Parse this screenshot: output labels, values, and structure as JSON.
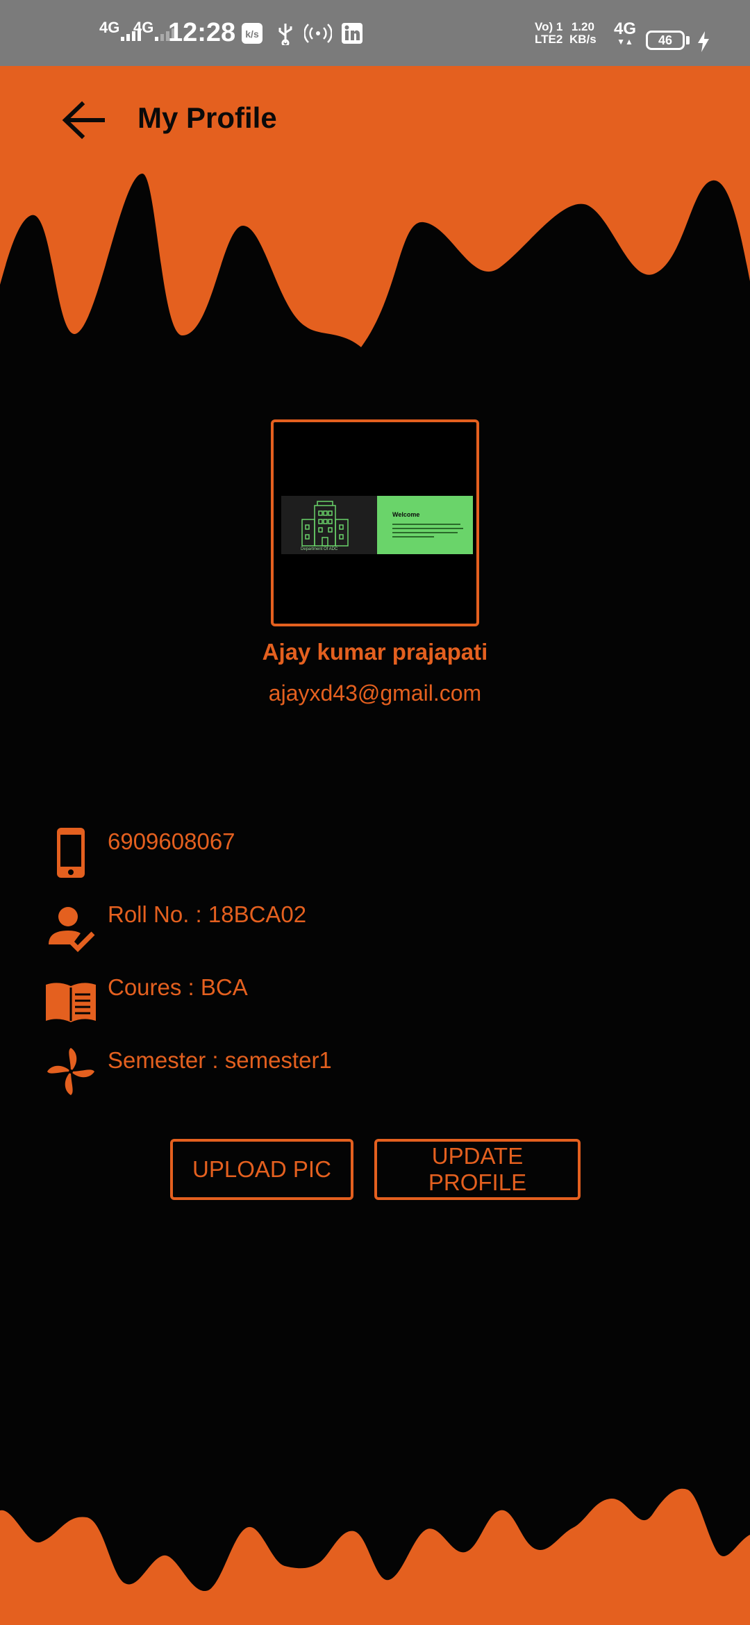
{
  "status_bar": {
    "net1": "4G",
    "net2": "4G",
    "time": "12:28",
    "volte_top": "Vo) 1",
    "volte_bottom": "LTE2",
    "speed_value": "1.20",
    "speed_unit": "KB/s",
    "net3": "4G",
    "battery": "46"
  },
  "app_bar": {
    "title": "My Profile"
  },
  "profile": {
    "thumbnail_heading": "Welcome",
    "thumbnail_caption": "Department Of ADC",
    "name": "Ajay kumar prajapati",
    "email": "ajayxd43@gmail.com"
  },
  "details": {
    "phone": "6909608067",
    "roll": "Roll No. : 18BCA02",
    "course": "Coures : BCA",
    "semester": "Semester : semester1"
  },
  "actions": {
    "upload_label": "UPLOAD PIC",
    "update_label": "UPDATE PROFILE"
  },
  "colors": {
    "accent": "#e4601f",
    "background": "#040404",
    "status_bar": "#7b7b7b",
    "thumbnail_green": "#6ad46a"
  }
}
